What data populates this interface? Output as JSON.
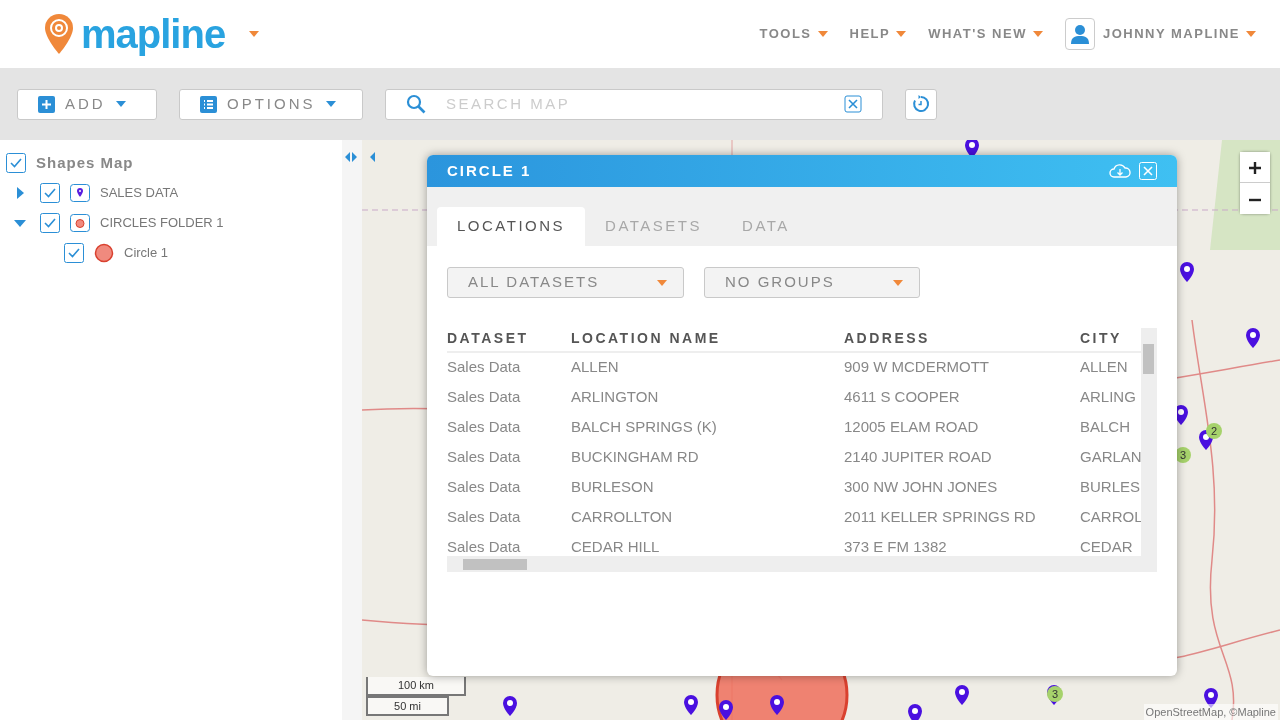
{
  "header": {
    "logo": "mapline",
    "menu": [
      {
        "label": "TOOLS"
      },
      {
        "label": "HELP"
      },
      {
        "label": "WHAT'S NEW"
      }
    ],
    "user": "JOHNNY MAPLINE"
  },
  "toolbar": {
    "buttons": [
      {
        "label": "ADD",
        "kind": "add"
      },
      {
        "label": "OPTIONS",
        "kind": "options"
      }
    ],
    "search": {
      "placeholder": "SEARCH MAP"
    }
  },
  "sidebar": {
    "tree": [
      {
        "label": "Shapes Map",
        "kind": "map",
        "checked": true,
        "children": [
          {
            "label": "SALES DATA",
            "kind": "dataset",
            "checked": true,
            "expanded": false
          },
          {
            "label": "CIRCLES FOLDER 1",
            "kind": "folder",
            "checked": true,
            "expanded": true,
            "children": [
              {
                "label": "Circle 1",
                "kind": "circle",
                "checked": true
              }
            ]
          }
        ]
      }
    ]
  },
  "map": {
    "clusters": [
      {
        "count": "2"
      },
      {
        "count": "3"
      },
      {
        "count": "3"
      }
    ],
    "scale": [
      "100 km",
      "50 mi"
    ],
    "attribution": "OpenStreetMap, ©Mapline"
  },
  "dialog": {
    "title": "CIRCLE 1",
    "tabs": [
      {
        "label": "LOCATIONS",
        "selected": true
      },
      {
        "label": "DATASETS",
        "selected": false
      },
      {
        "label": "DATA",
        "selected": false
      }
    ],
    "filters": [
      "ALL DATASETS",
      "NO GROUPS"
    ],
    "table": {
      "columns": [
        "DATASET",
        "LOCATION NAME",
        "ADDRESS",
        "CITY"
      ],
      "rows": [
        [
          "Sales Data",
          "ALLEN",
          "909 W MCDERMOTT",
          "ALLEN"
        ],
        [
          "Sales Data",
          "ARLINGTON",
          "4611 S COOPER",
          "ARLING"
        ],
        [
          "Sales Data",
          "BALCH SPRINGS (K)",
          "12005 ELAM ROAD",
          "BALCH"
        ],
        [
          "Sales Data",
          "BUCKINGHAM RD",
          "2140 JUPITER ROAD",
          "GARLAN"
        ],
        [
          "Sales Data",
          "BURLESON",
          "300 NW JOHN JONES",
          "BURLES"
        ],
        [
          "Sales Data",
          "CARROLLTON",
          "2011 KELLER SPRINGS RD",
          "CARROL"
        ],
        [
          "Sales Data",
          "CEDAR HILL",
          "373 E FM 1382",
          "CEDAR"
        ]
      ]
    }
  }
}
